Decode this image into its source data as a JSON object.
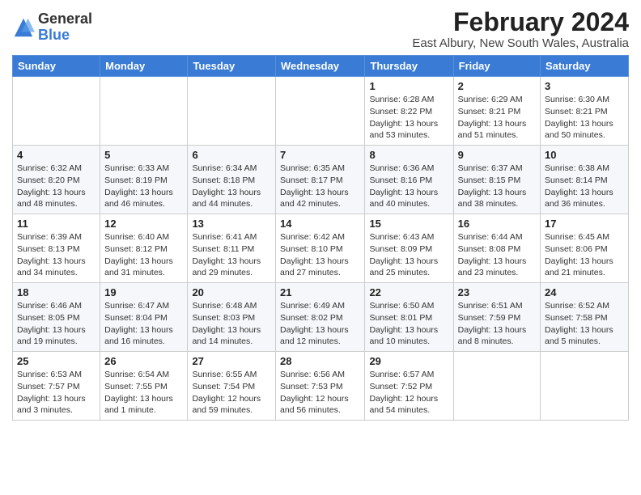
{
  "logo": {
    "general": "General",
    "blue": "Blue"
  },
  "title": "February 2024",
  "subtitle": "East Albury, New South Wales, Australia",
  "weekdays": [
    "Sunday",
    "Monday",
    "Tuesday",
    "Wednesday",
    "Thursday",
    "Friday",
    "Saturday"
  ],
  "weeks": [
    [
      {
        "day": "",
        "info": ""
      },
      {
        "day": "",
        "info": ""
      },
      {
        "day": "",
        "info": ""
      },
      {
        "day": "",
        "info": ""
      },
      {
        "day": "1",
        "info": "Sunrise: 6:28 AM\nSunset: 8:22 PM\nDaylight: 13 hours\nand 53 minutes."
      },
      {
        "day": "2",
        "info": "Sunrise: 6:29 AM\nSunset: 8:21 PM\nDaylight: 13 hours\nand 51 minutes."
      },
      {
        "day": "3",
        "info": "Sunrise: 6:30 AM\nSunset: 8:21 PM\nDaylight: 13 hours\nand 50 minutes."
      }
    ],
    [
      {
        "day": "4",
        "info": "Sunrise: 6:32 AM\nSunset: 8:20 PM\nDaylight: 13 hours\nand 48 minutes."
      },
      {
        "day": "5",
        "info": "Sunrise: 6:33 AM\nSunset: 8:19 PM\nDaylight: 13 hours\nand 46 minutes."
      },
      {
        "day": "6",
        "info": "Sunrise: 6:34 AM\nSunset: 8:18 PM\nDaylight: 13 hours\nand 44 minutes."
      },
      {
        "day": "7",
        "info": "Sunrise: 6:35 AM\nSunset: 8:17 PM\nDaylight: 13 hours\nand 42 minutes."
      },
      {
        "day": "8",
        "info": "Sunrise: 6:36 AM\nSunset: 8:16 PM\nDaylight: 13 hours\nand 40 minutes."
      },
      {
        "day": "9",
        "info": "Sunrise: 6:37 AM\nSunset: 8:15 PM\nDaylight: 13 hours\nand 38 minutes."
      },
      {
        "day": "10",
        "info": "Sunrise: 6:38 AM\nSunset: 8:14 PM\nDaylight: 13 hours\nand 36 minutes."
      }
    ],
    [
      {
        "day": "11",
        "info": "Sunrise: 6:39 AM\nSunset: 8:13 PM\nDaylight: 13 hours\nand 34 minutes."
      },
      {
        "day": "12",
        "info": "Sunrise: 6:40 AM\nSunset: 8:12 PM\nDaylight: 13 hours\nand 31 minutes."
      },
      {
        "day": "13",
        "info": "Sunrise: 6:41 AM\nSunset: 8:11 PM\nDaylight: 13 hours\nand 29 minutes."
      },
      {
        "day": "14",
        "info": "Sunrise: 6:42 AM\nSunset: 8:10 PM\nDaylight: 13 hours\nand 27 minutes."
      },
      {
        "day": "15",
        "info": "Sunrise: 6:43 AM\nSunset: 8:09 PM\nDaylight: 13 hours\nand 25 minutes."
      },
      {
        "day": "16",
        "info": "Sunrise: 6:44 AM\nSunset: 8:08 PM\nDaylight: 13 hours\nand 23 minutes."
      },
      {
        "day": "17",
        "info": "Sunrise: 6:45 AM\nSunset: 8:06 PM\nDaylight: 13 hours\nand 21 minutes."
      }
    ],
    [
      {
        "day": "18",
        "info": "Sunrise: 6:46 AM\nSunset: 8:05 PM\nDaylight: 13 hours\nand 19 minutes."
      },
      {
        "day": "19",
        "info": "Sunrise: 6:47 AM\nSunset: 8:04 PM\nDaylight: 13 hours\nand 16 minutes."
      },
      {
        "day": "20",
        "info": "Sunrise: 6:48 AM\nSunset: 8:03 PM\nDaylight: 13 hours\nand 14 minutes."
      },
      {
        "day": "21",
        "info": "Sunrise: 6:49 AM\nSunset: 8:02 PM\nDaylight: 13 hours\nand 12 minutes."
      },
      {
        "day": "22",
        "info": "Sunrise: 6:50 AM\nSunset: 8:01 PM\nDaylight: 13 hours\nand 10 minutes."
      },
      {
        "day": "23",
        "info": "Sunrise: 6:51 AM\nSunset: 7:59 PM\nDaylight: 13 hours\nand 8 minutes."
      },
      {
        "day": "24",
        "info": "Sunrise: 6:52 AM\nSunset: 7:58 PM\nDaylight: 13 hours\nand 5 minutes."
      }
    ],
    [
      {
        "day": "25",
        "info": "Sunrise: 6:53 AM\nSunset: 7:57 PM\nDaylight: 13 hours\nand 3 minutes."
      },
      {
        "day": "26",
        "info": "Sunrise: 6:54 AM\nSunset: 7:55 PM\nDaylight: 13 hours\nand 1 minute."
      },
      {
        "day": "27",
        "info": "Sunrise: 6:55 AM\nSunset: 7:54 PM\nDaylight: 12 hours\nand 59 minutes."
      },
      {
        "day": "28",
        "info": "Sunrise: 6:56 AM\nSunset: 7:53 PM\nDaylight: 12 hours\nand 56 minutes."
      },
      {
        "day": "29",
        "info": "Sunrise: 6:57 AM\nSunset: 7:52 PM\nDaylight: 12 hours\nand 54 minutes."
      },
      {
        "day": "",
        "info": ""
      },
      {
        "day": "",
        "info": ""
      }
    ]
  ]
}
